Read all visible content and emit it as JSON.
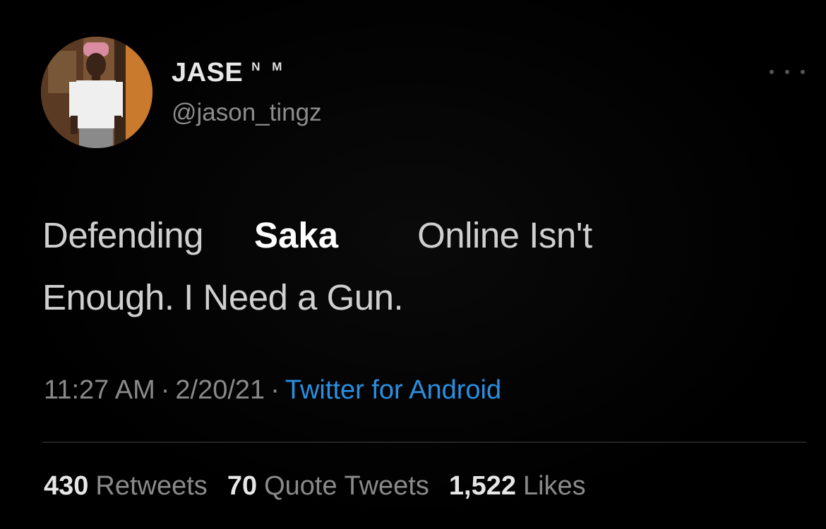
{
  "author": {
    "display_name": "JASE",
    "name_suffix": "N M",
    "handle": "@jason_tingz",
    "avatar_icon": "user-avatar-photo"
  },
  "more_icon": "more-dots-icon",
  "tweet": {
    "line1_part1": "Defending",
    "line1_highlight": "Saka",
    "line1_part2": "Online Isn't",
    "line2": "Enough. I Need a Gun."
  },
  "meta": {
    "time": "11:27 AM",
    "separator": "·",
    "date": "2/20/21",
    "source": "Twitter for Android"
  },
  "stats": {
    "retweets_count": "430",
    "retweets_label": "Retweets",
    "quotes_count": "70",
    "quotes_label": "Quote Tweets",
    "likes_count": "1,522",
    "likes_label": "Likes"
  },
  "colors": {
    "background": "#000000",
    "text": "#cfcfcf",
    "muted": "#8a8a8a",
    "link": "#2a8fe0"
  }
}
